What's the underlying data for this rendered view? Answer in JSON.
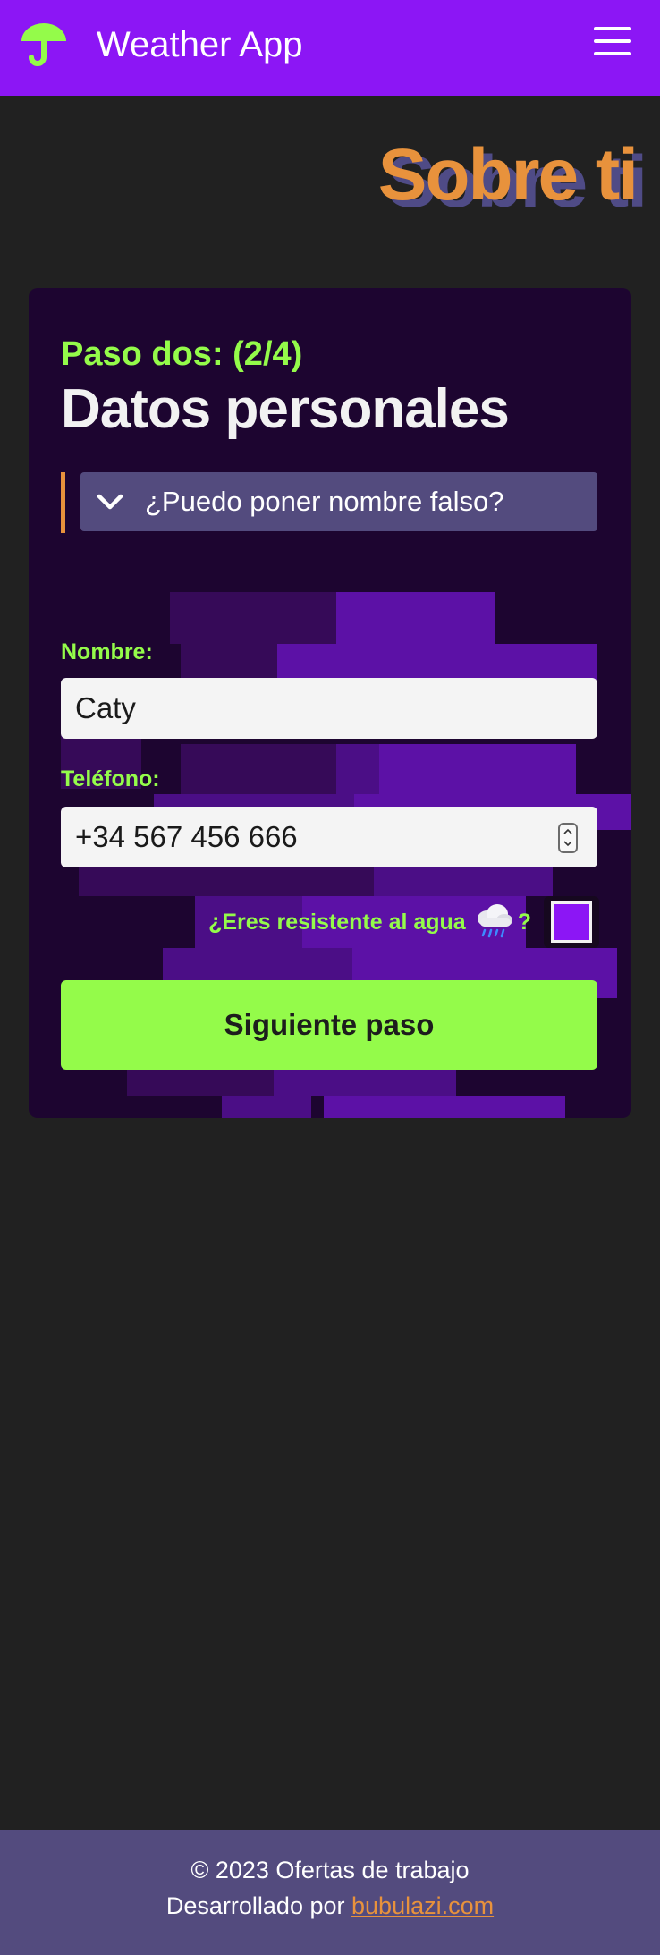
{
  "header": {
    "logo_icon": "umbrella-icon",
    "app_title": "Weather App",
    "menu_icon": "hamburger-menu-icon"
  },
  "hero": {
    "title": "Sobre ti"
  },
  "form": {
    "step": "Paso dos: (2/4)",
    "title": "Datos personales",
    "faq": {
      "icon": "chevron-down-icon",
      "question": "¿Puedo poner nombre falso?"
    },
    "name": {
      "label": "Nombre:",
      "value": "Caty"
    },
    "phone": {
      "label": "Teléfono:",
      "value": "+34 567 456 666"
    },
    "water": {
      "label": "¿Eres resistente al agua",
      "icon": "rain-cloud-icon",
      "suffix": "?",
      "checked": false
    },
    "submit_label": "Siguiente paso"
  },
  "footer": {
    "copyright": "© 2023 Ofertas de trabajo",
    "developed_by": "Desarrollado por",
    "link_text": "bubulazi.com"
  },
  "colors": {
    "brand_purple": "#8c16f5",
    "accent_green": "#94fb4a",
    "accent_orange": "#e8923c",
    "slate": "#534b7e",
    "background": "#212121",
    "card": "#1d0530"
  }
}
